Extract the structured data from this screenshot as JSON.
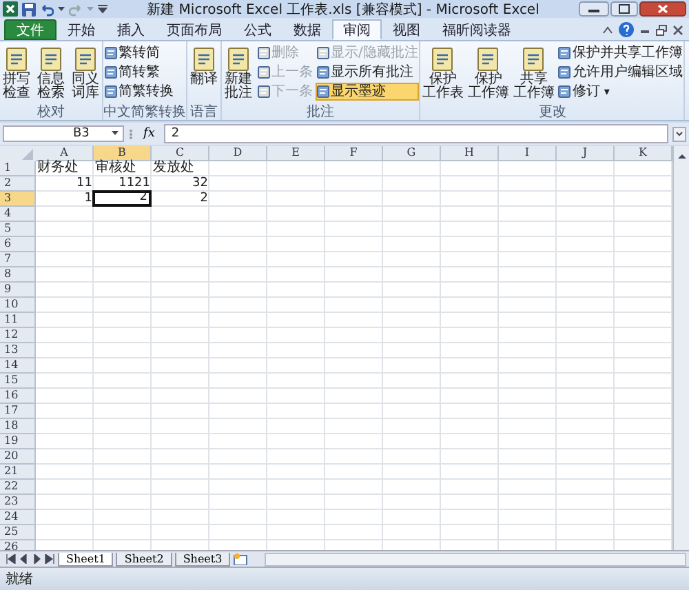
{
  "window": {
    "title": "新建 Microsoft Excel 工作表.xls  [兼容模式] - Microsoft Excel"
  },
  "tabs": [
    {
      "label": "文件",
      "kind": "file",
      "selected": false
    },
    {
      "label": "开始",
      "kind": "tab",
      "selected": false
    },
    {
      "label": "插入",
      "kind": "tab",
      "selected": false
    },
    {
      "label": "页面布局",
      "kind": "tab",
      "selected": false
    },
    {
      "label": "公式",
      "kind": "tab",
      "selected": false
    },
    {
      "label": "数据",
      "kind": "tab",
      "selected": false
    },
    {
      "label": "审阅",
      "kind": "tab",
      "selected": true
    },
    {
      "label": "视图",
      "kind": "tab",
      "selected": false
    },
    {
      "label": "福昕阅读器",
      "kind": "tab",
      "selected": false
    }
  ],
  "ribbon": {
    "groups": [
      {
        "label": "校对",
        "items": [
          {
            "lines": [
              "拼写检查"
            ],
            "kind": "large",
            "disabled": false,
            "selected": false
          },
          {
            "lines": [
              "信息检索"
            ],
            "kind": "large",
            "disabled": false,
            "selected": false
          },
          {
            "lines": [
              "同义词库"
            ],
            "kind": "large",
            "disabled": false,
            "selected": false
          }
        ]
      },
      {
        "label": "中文简繁转换",
        "items": [
          {
            "label": "繁转简",
            "kind": "small",
            "disabled": false,
            "selected": false
          },
          {
            "label": "简转繁",
            "kind": "small",
            "disabled": false,
            "selected": false
          },
          {
            "label": "简繁转换",
            "kind": "small",
            "disabled": false,
            "selected": false
          }
        ]
      },
      {
        "label": "语言",
        "items": [
          {
            "lines": [
              "翻译"
            ],
            "kind": "large",
            "disabled": false,
            "selected": false
          }
        ]
      },
      {
        "label": "批注",
        "items": [
          {
            "lines": [
              "新建批注"
            ],
            "kind": "large",
            "disabled": false,
            "selected": false
          },
          {
            "label": "删除",
            "kind": "small",
            "disabled": true,
            "selected": false
          },
          {
            "label": "上一条",
            "kind": "small",
            "disabled": true,
            "selected": false
          },
          {
            "label": "下一条",
            "kind": "small",
            "disabled": true,
            "selected": false
          },
          {
            "label": "显示/隐藏批注",
            "kind": "small",
            "disabled": true,
            "selected": false
          },
          {
            "label": "显示所有批注",
            "kind": "small",
            "disabled": false,
            "selected": false
          },
          {
            "label": "显示墨迹",
            "kind": "small",
            "disabled": false,
            "selected": true
          }
        ]
      },
      {
        "label": "更改",
        "items": [
          {
            "lines": [
              "保护",
              "工作表"
            ],
            "kind": "large",
            "disabled": false,
            "selected": false
          },
          {
            "lines": [
              "保护",
              "工作簿"
            ],
            "kind": "large",
            "disabled": false,
            "selected": false
          },
          {
            "lines": [
              "共享",
              "工作簿"
            ],
            "kind": "large",
            "disabled": false,
            "selected": false
          },
          {
            "label": "保护并共享工作簿",
            "kind": "small",
            "disabled": false,
            "selected": false
          },
          {
            "label": "允许用户编辑区域",
            "kind": "small",
            "disabled": false,
            "selected": false
          },
          {
            "label": "修订",
            "kind": "small",
            "disabled": false,
            "selected": false,
            "caret": "▾"
          }
        ]
      }
    ]
  },
  "formula_bar": {
    "name_box": "B3",
    "fx": "fx",
    "value": "2"
  },
  "sheet": {
    "columns": [
      "A",
      "B",
      "C",
      "D",
      "E",
      "F",
      "G",
      "H",
      "I",
      "J",
      "K"
    ],
    "row_numbers": [
      "1",
      "2",
      "3",
      "4",
      "5",
      "6",
      "7",
      "8",
      "9",
      "10",
      "11",
      "12",
      "13",
      "14",
      "15",
      "16",
      "17",
      "18",
      "19",
      "20",
      "21",
      "22",
      "23",
      "24",
      "25",
      "26"
    ],
    "rows": [
      {
        "cells": [
          {
            "text": "财务处",
            "kind": "text",
            "selected": false
          },
          {
            "text": "审核处",
            "kind": "text",
            "selected": false
          },
          {
            "text": "发放处",
            "kind": "text",
            "selected": false
          }
        ]
      },
      {
        "cells": [
          {
            "text": "11",
            "kind": "number",
            "selected": false
          },
          {
            "text": "1121",
            "kind": "number",
            "selected": false
          },
          {
            "text": "32",
            "kind": "number",
            "selected": false
          }
        ]
      },
      {
        "cells": [
          {
            "text": "1",
            "kind": "number",
            "selected": false
          },
          {
            "text": "2",
            "kind": "number",
            "selected": true
          },
          {
            "text": "2",
            "kind": "number",
            "selected": false
          }
        ]
      }
    ]
  },
  "sheet_tabs": [
    {
      "label": "Sheet1",
      "selected": true
    },
    {
      "label": "Sheet2",
      "selected": false
    },
    {
      "label": "Sheet3",
      "selected": false
    }
  ],
  "status_bar": {
    "text": "就绪"
  }
}
